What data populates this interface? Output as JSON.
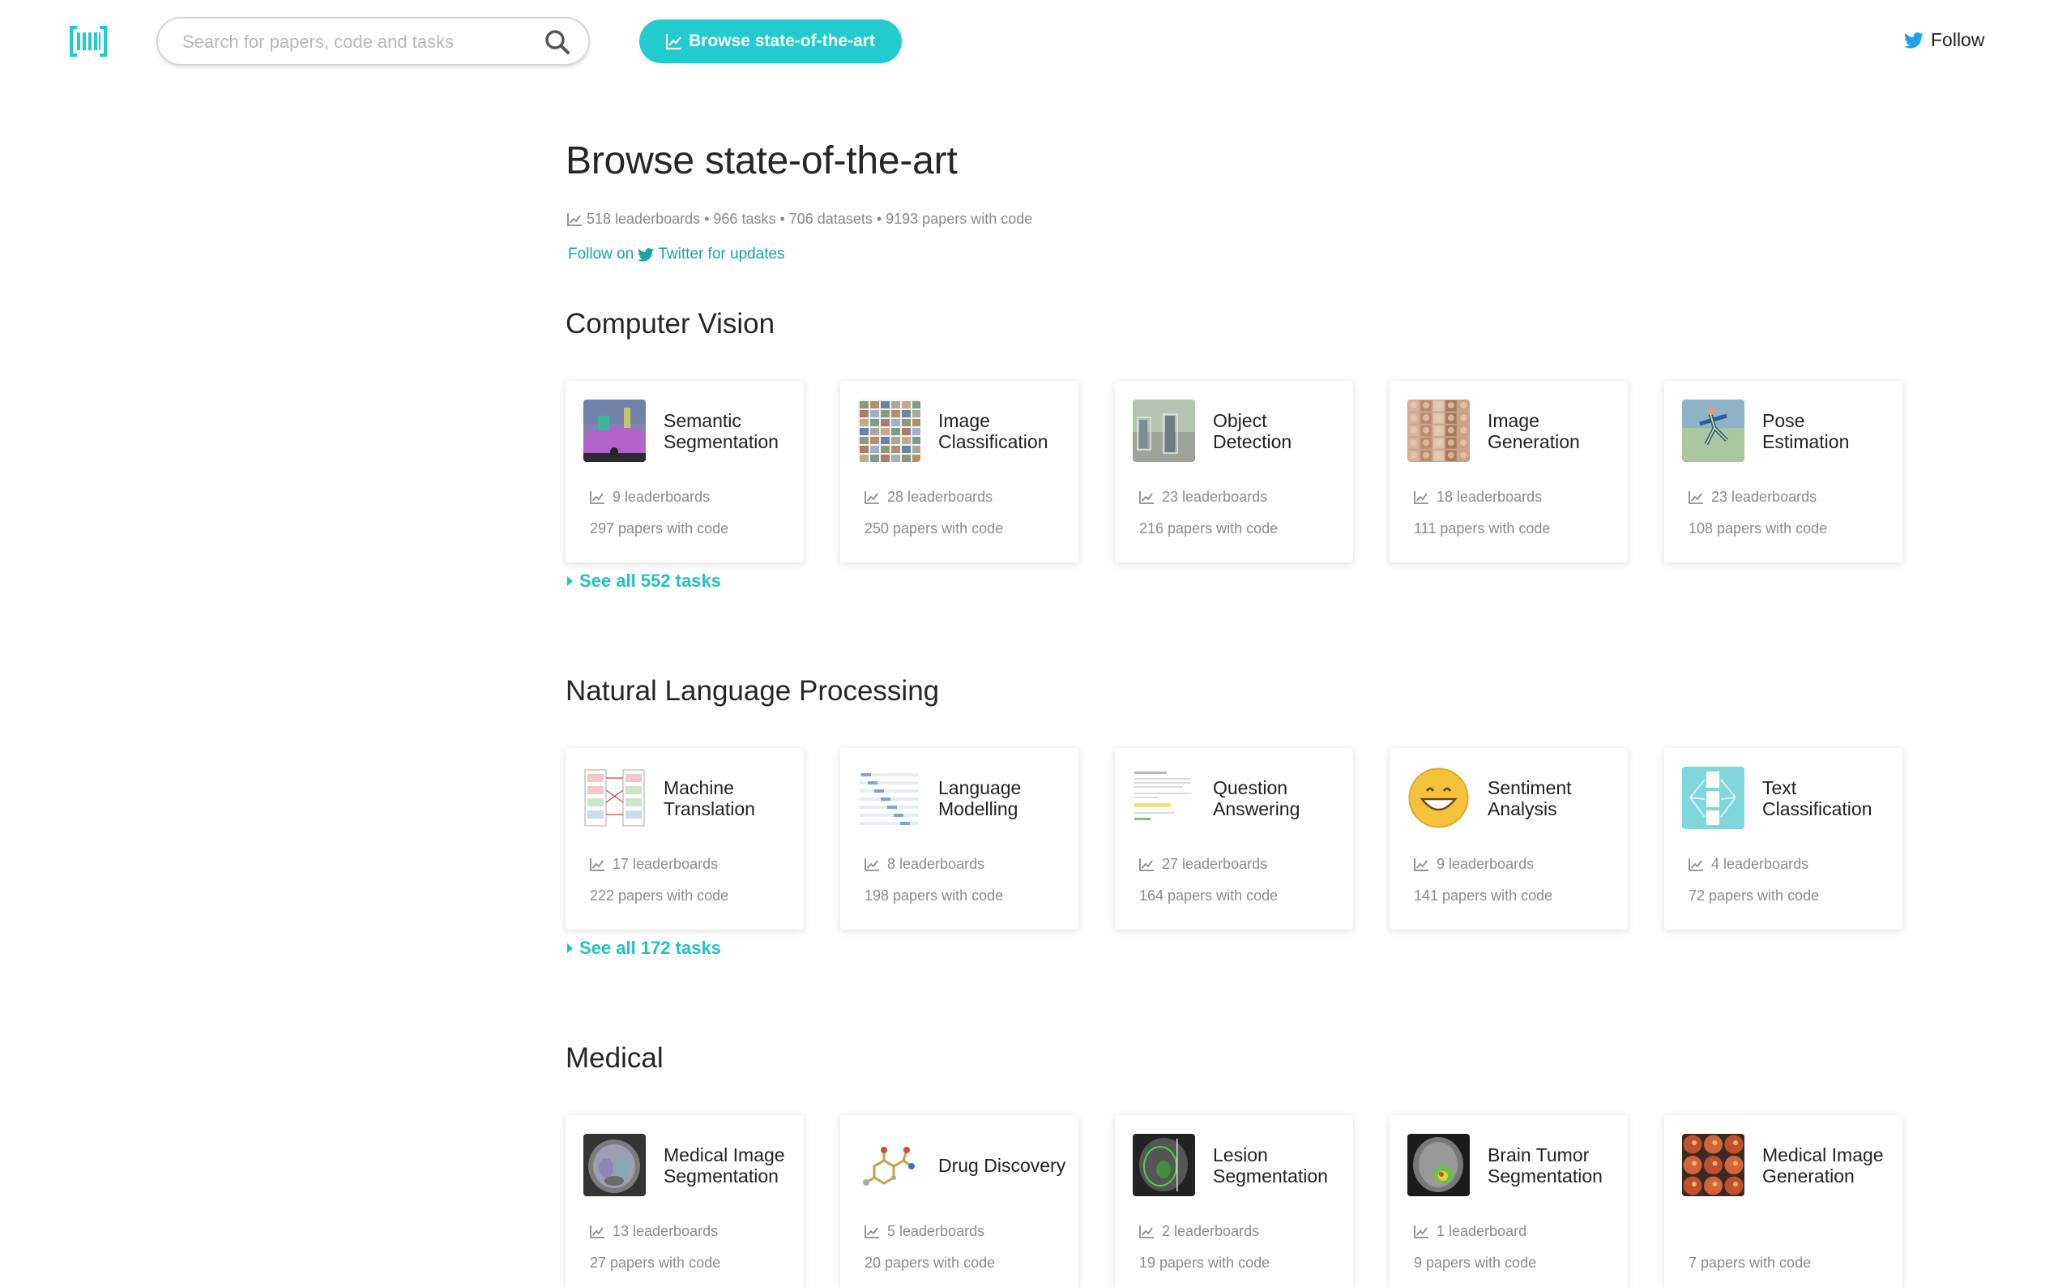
{
  "header": {
    "search_placeholder": "Search for papers, code and tasks",
    "browse_label": "Browse state-of-the-art",
    "follow_label": "Follow"
  },
  "page": {
    "title": "Browse state-of-the-art",
    "stats": "518 leaderboards • 966 tasks • 706 datasets • 9193 papers with code",
    "twitter_prefix": "Follow on",
    "twitter_suffix": "Twitter for updates"
  },
  "sections": [
    {
      "title": "Computer Vision",
      "see_all": "See all 552 tasks",
      "cards": [
        {
          "title": "Semantic Segmentation",
          "leaderboards": "9 leaderboards",
          "papers": "297 papers with code",
          "thumb": "segmentation"
        },
        {
          "title": "Image Classification",
          "leaderboards": "28 leaderboards",
          "papers": "250 papers with code",
          "thumb": "grid"
        },
        {
          "title": "Object Detection",
          "leaderboards": "23 leaderboards",
          "papers": "216 papers with code",
          "thumb": "street"
        },
        {
          "title": "Image Generation",
          "leaderboards": "18 leaderboards",
          "papers": "111 papers with code",
          "thumb": "faces"
        },
        {
          "title": "Pose Estimation",
          "leaderboards": "23 leaderboards",
          "papers": "108 papers with code",
          "thumb": "pose"
        }
      ]
    },
    {
      "title": "Natural Language Processing",
      "see_all": "See all 172 tasks",
      "cards": [
        {
          "title": "Machine Translation",
          "leaderboards": "17 leaderboards",
          "papers": "222 papers with code",
          "thumb": "translation"
        },
        {
          "title": "Language Modelling",
          "leaderboards": "8 leaderboards",
          "papers": "198 papers with code",
          "thumb": "lm"
        },
        {
          "title": "Question Answering",
          "leaderboards": "27 leaderboards",
          "papers": "164 papers with code",
          "thumb": "qa"
        },
        {
          "title": "Sentiment Analysis",
          "leaderboards": "9 leaderboards",
          "papers": "141 papers with code",
          "thumb": "smiley"
        },
        {
          "title": "Text Classification",
          "leaderboards": "4 leaderboards",
          "papers": "72 papers with code",
          "thumb": "textcls"
        }
      ]
    },
    {
      "title": "Medical",
      "see_all": "",
      "cards": [
        {
          "title": "Medical Image Segmentation",
          "leaderboards": "13 leaderboards",
          "papers": "27 papers with code",
          "thumb": "mri"
        },
        {
          "title": "Drug Discovery",
          "leaderboards": "5 leaderboards",
          "papers": "20 papers with code",
          "thumb": "molecule"
        },
        {
          "title": "Lesion Segmentation",
          "leaderboards": "2 leaderboards",
          "papers": "19 papers with code",
          "thumb": "lesion"
        },
        {
          "title": "Brain Tumor Segmentation",
          "leaderboards": "1 leaderboard",
          "papers": "9 papers with code",
          "thumb": "brain"
        },
        {
          "title": "Medical Image Generation",
          "leaderboards": "",
          "papers": "7 papers with code",
          "thumb": "retina"
        }
      ]
    }
  ],
  "colors": {
    "accent": "#21cbce",
    "link": "#18a3a6",
    "twitter": "#1da1f2"
  }
}
